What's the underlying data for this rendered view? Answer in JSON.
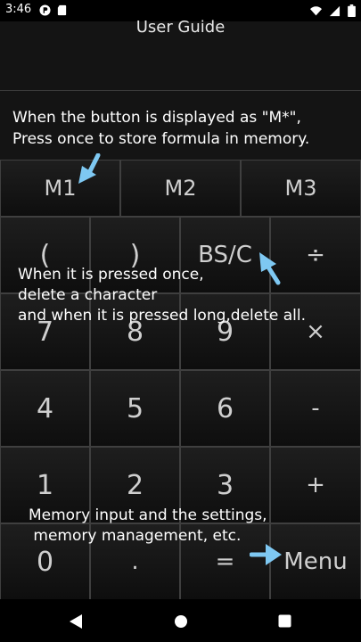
{
  "status_bar": {
    "time": "3:46",
    "icons_left": [
      "p-badge-icon",
      "sd-card-icon"
    ],
    "icons_right": [
      "wifi-icon",
      "signal-icon",
      "battery-icon"
    ]
  },
  "header": {
    "title": "User Guide"
  },
  "guide": {
    "memory_text": "When the button is displayed as \"M*\",\nPress once to store formula in memory."
  },
  "memory_keys": [
    "M1",
    "M2",
    "M3"
  ],
  "keypad": [
    [
      "(",
      ")",
      "BS/C",
      "÷"
    ],
    [
      "7",
      "8",
      "9",
      "×"
    ],
    [
      "4",
      "5",
      "6",
      "-"
    ],
    [
      "1",
      "2",
      "3",
      "+"
    ],
    [
      "0",
      ".",
      "=",
      "Menu"
    ]
  ],
  "overlays": {
    "bsc_text": "When it is pressed once,\ndelete a character\nand when it is pressed long,delete all.",
    "menu_text": "Memory input and the settings,\n memory management, etc."
  },
  "colors": {
    "accent_arrow": "#7ec8f2",
    "background": "#000000"
  },
  "nav_bar": {
    "icons": [
      "back-icon",
      "home-icon",
      "recents-icon"
    ]
  }
}
